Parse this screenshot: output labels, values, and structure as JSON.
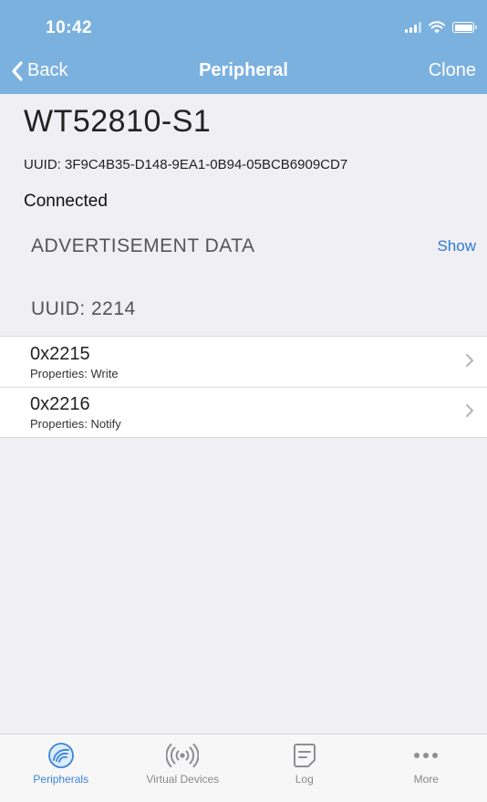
{
  "status_bar": {
    "time": "10:42"
  },
  "nav": {
    "back_label": "Back",
    "title": "Peripheral",
    "action_label": "Clone"
  },
  "peripheral": {
    "name": "WT52810-S1",
    "uuid_line": "UUID: 3F9C4B35-D148-9EA1-0B94-05BCB6909CD7",
    "status": "Connected"
  },
  "advertisement": {
    "header": "ADVERTISEMENT DATA",
    "action_label": "Show"
  },
  "service": {
    "uuid_label": "UUID: 2214",
    "characteristics": [
      {
        "name": "0x2215",
        "properties": "Properties: Write"
      },
      {
        "name": "0x2216",
        "properties": "Properties: Notify"
      }
    ]
  },
  "tabs": [
    {
      "label": "Peripherals",
      "icon": "peripherals-icon",
      "active": true
    },
    {
      "label": "Virtual Devices",
      "icon": "broadcast-icon",
      "active": false
    },
    {
      "label": "Log",
      "icon": "log-icon",
      "active": false
    },
    {
      "label": "More",
      "icon": "more-icon",
      "active": false
    }
  ],
  "colors": {
    "nav_bar": "#7bb1df",
    "accent": "#3a84d9",
    "link": "#2c79d3",
    "background": "#efeff4"
  }
}
